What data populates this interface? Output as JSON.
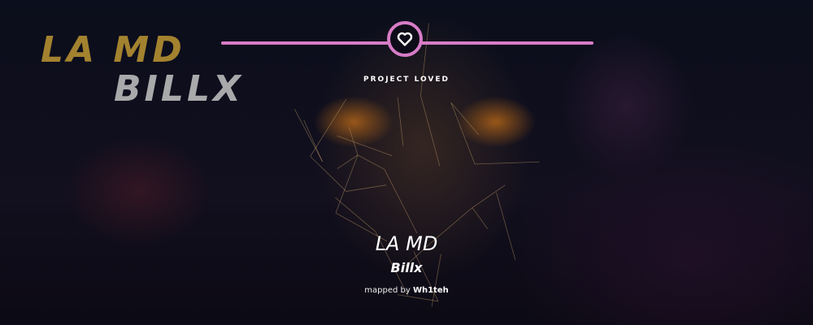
{
  "artwork_logo": {
    "line1": "LA MD",
    "line2": "BILLX"
  },
  "status": {
    "label": "PROJECT LOVED",
    "icon": "heart-icon",
    "color": "#d77cc7"
  },
  "beatmap": {
    "title": "LA MD",
    "artist": "Billx",
    "mapped_by_label": "mapped by",
    "mapper": "Wh1teh"
  }
}
